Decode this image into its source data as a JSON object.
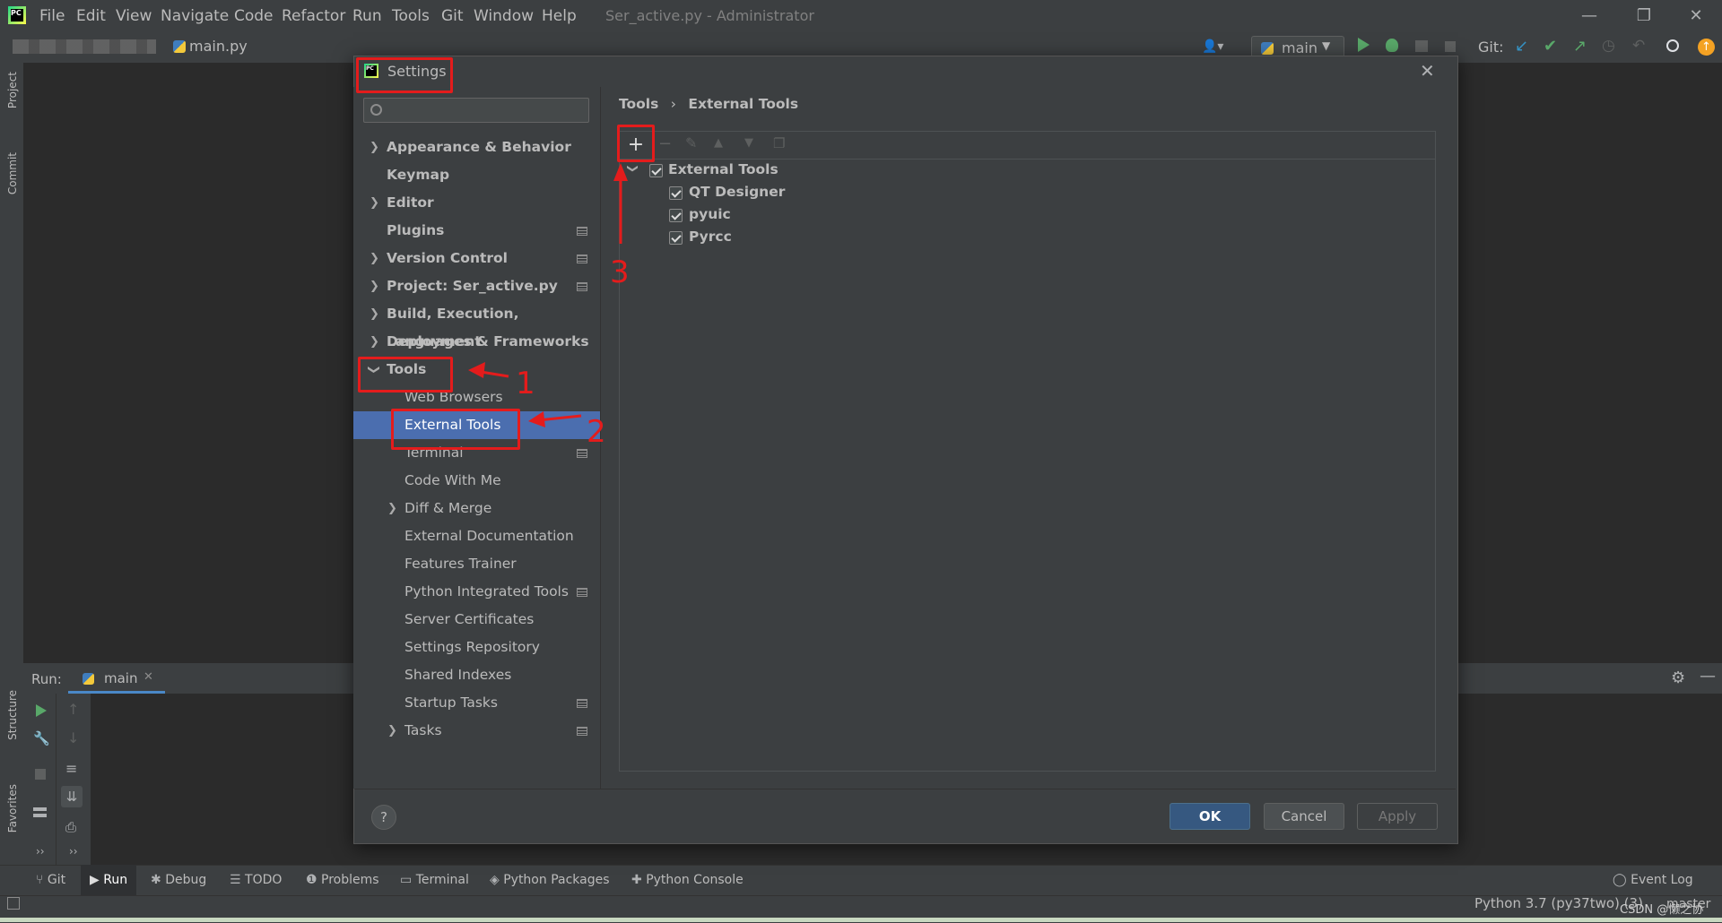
{
  "app": {
    "title": "Ser_active.py - Administrator",
    "menu": [
      "File",
      "Edit",
      "View",
      "Navigate",
      "Code",
      "Refactor",
      "Run",
      "Tools",
      "Git",
      "Window",
      "Help"
    ]
  },
  "navbar": {
    "file": "main.py",
    "run_config": "main",
    "git_label": "Git:"
  },
  "left_strip": {
    "project": "Project",
    "commit": "Commit",
    "structure": "Structure",
    "favorites": "Favorites"
  },
  "run_panel": {
    "label": "Run:",
    "tab": "main"
  },
  "dialog": {
    "title": "Settings",
    "search_placeholder": "",
    "breadcrumb": {
      "parent": "Tools",
      "sep": "›",
      "current": "External Tools"
    },
    "tree": [
      {
        "label": "Appearance & Behavior"
      },
      {
        "label": "Keymap"
      },
      {
        "label": "Editor"
      },
      {
        "label": "Plugins"
      },
      {
        "label": "Version Control"
      },
      {
        "label": "Project: Ser_active.py"
      },
      {
        "label": "Build, Execution, Deployment"
      },
      {
        "label": "Languages & Frameworks"
      },
      {
        "label": "Tools"
      },
      {
        "label": "Web Browsers"
      },
      {
        "label": "External Tools"
      },
      {
        "label": "Terminal"
      },
      {
        "label": "Code With Me"
      },
      {
        "label": "Diff & Merge"
      },
      {
        "label": "External Documentation"
      },
      {
        "label": "Features Trainer"
      },
      {
        "label": "Python Integrated Tools"
      },
      {
        "label": "Server Certificates"
      },
      {
        "label": "Settings Repository"
      },
      {
        "label": "Shared Indexes"
      },
      {
        "label": "Startup Tasks"
      },
      {
        "label": "Tasks"
      }
    ],
    "tools_tree": {
      "group": "External Tools",
      "items": [
        "QT Designer",
        "pyuic",
        "Pyrcc"
      ]
    },
    "buttons": {
      "ok": "OK",
      "cancel": "Cancel",
      "apply": "Apply",
      "help": "?"
    }
  },
  "annotations": [
    "1",
    "2",
    "3"
  ],
  "bottom_tabs": [
    "Git",
    "Run",
    "Debug",
    "TODO",
    "Problems",
    "Terminal",
    "Python Packages",
    "Python Console"
  ],
  "event_log": "Event Log",
  "status": {
    "interpreter": "Python 3.7 (py37two) (3)",
    "branch": "master",
    "watermark": "CSDN @懒之协"
  },
  "colors": {
    "accent": "#4b6eaf",
    "annotation": "#e41c1c",
    "run_green": "#59a869"
  }
}
